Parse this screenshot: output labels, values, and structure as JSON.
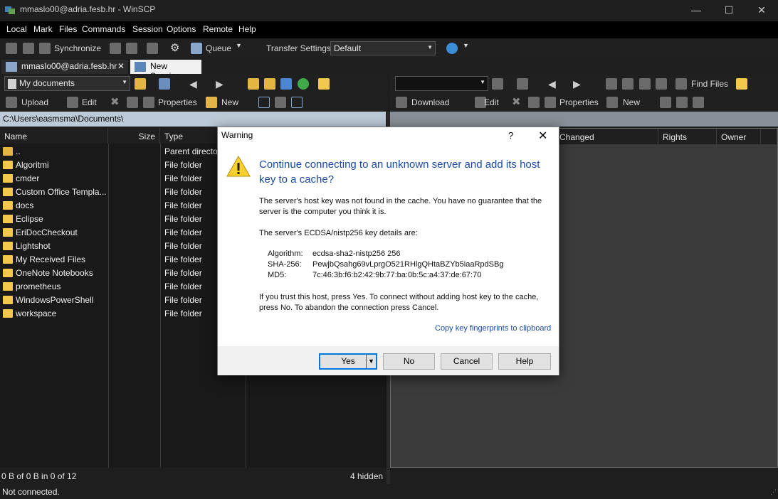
{
  "window": {
    "title": "mmaslo00@adria.fesb.hr - WinSCP",
    "minimize": "—",
    "maximize": "☐",
    "close": "✕"
  },
  "menu": [
    "Local",
    "Mark",
    "Files",
    "Commands",
    "Session",
    "Options",
    "Remote",
    "Help"
  ],
  "toolbar": {
    "synchronize": "Synchronize",
    "queue": "Queue",
    "transfer_settings_label": "Transfer Settings",
    "transfer_settings_value": "Default"
  },
  "tabs": {
    "session": "mmaslo00@adria.fesb.hr",
    "new_session": "New Session"
  },
  "left_panel": {
    "location": "My documents",
    "upload": "Upload",
    "edit": "Edit",
    "properties": "Properties",
    "new": "New",
    "path": "C:\\Users\\easmsma\\Documents\\",
    "columns": {
      "name": "Name",
      "size": "Size",
      "type": "Type"
    },
    "rows": [
      {
        "name": "..",
        "type": "Parent directory"
      },
      {
        "name": "Algoritmi",
        "type": "File folder"
      },
      {
        "name": "cmder",
        "type": "File folder"
      },
      {
        "name": "Custom Office Templa...",
        "type": "File folder"
      },
      {
        "name": "docs",
        "type": "File folder"
      },
      {
        "name": "Eclipse",
        "type": "File folder"
      },
      {
        "name": "EriDocCheckout",
        "type": "File folder"
      },
      {
        "name": "Lightshot",
        "type": "File folder"
      },
      {
        "name": "My Received Files",
        "type": "File folder"
      },
      {
        "name": "OneNote Notebooks",
        "type": "File folder"
      },
      {
        "name": "prometheus",
        "type": "File folder"
      },
      {
        "name": "WindowsPowerShell",
        "type": "File folder"
      },
      {
        "name": "workspace",
        "type": "File folder"
      }
    ],
    "status_left": "0 B of 0 B in 0 of 12",
    "status_right": "4 hidden"
  },
  "right_panel": {
    "find_files": "Find Files",
    "download": "Download",
    "edit": "Edit",
    "properties": "Properties",
    "new": "New",
    "columns": {
      "changed": "Changed",
      "rights": "Rights",
      "owner": "Owner"
    }
  },
  "dialog": {
    "title": "Warning",
    "help": "?",
    "close": "✕",
    "heading": "Continue connecting to an unknown server and add its host key to a cache?",
    "para1": "The server's host key was not found in the cache. You have no guarantee that the server is the computer you think it is.",
    "para2": "The server's ECDSA/nistp256 key details are:",
    "algorithm_label": "Algorithm:",
    "algorithm_value": "ecdsa-sha2-nistp256 256",
    "sha_label": "SHA-256:",
    "sha_value": "PewjbQsahg69vLprgO521RHlgQHtaBZYb5iaaRpdSBg",
    "md5_label": "MD5:",
    "md5_value": "7c:46:3b:f6:b2:42:9b:77:ba:0b:5c:a4:37:de:67:70",
    "para3": "If you trust this host, press Yes. To connect without adding host key to the cache, press No. To abandon the connection press Cancel.",
    "copy_link": "Copy key fingerprints to clipboard",
    "buttons": {
      "yes": "Yes",
      "no": "No",
      "cancel": "Cancel",
      "help": "Help"
    }
  },
  "statusbar": {
    "text": "Not connected."
  }
}
